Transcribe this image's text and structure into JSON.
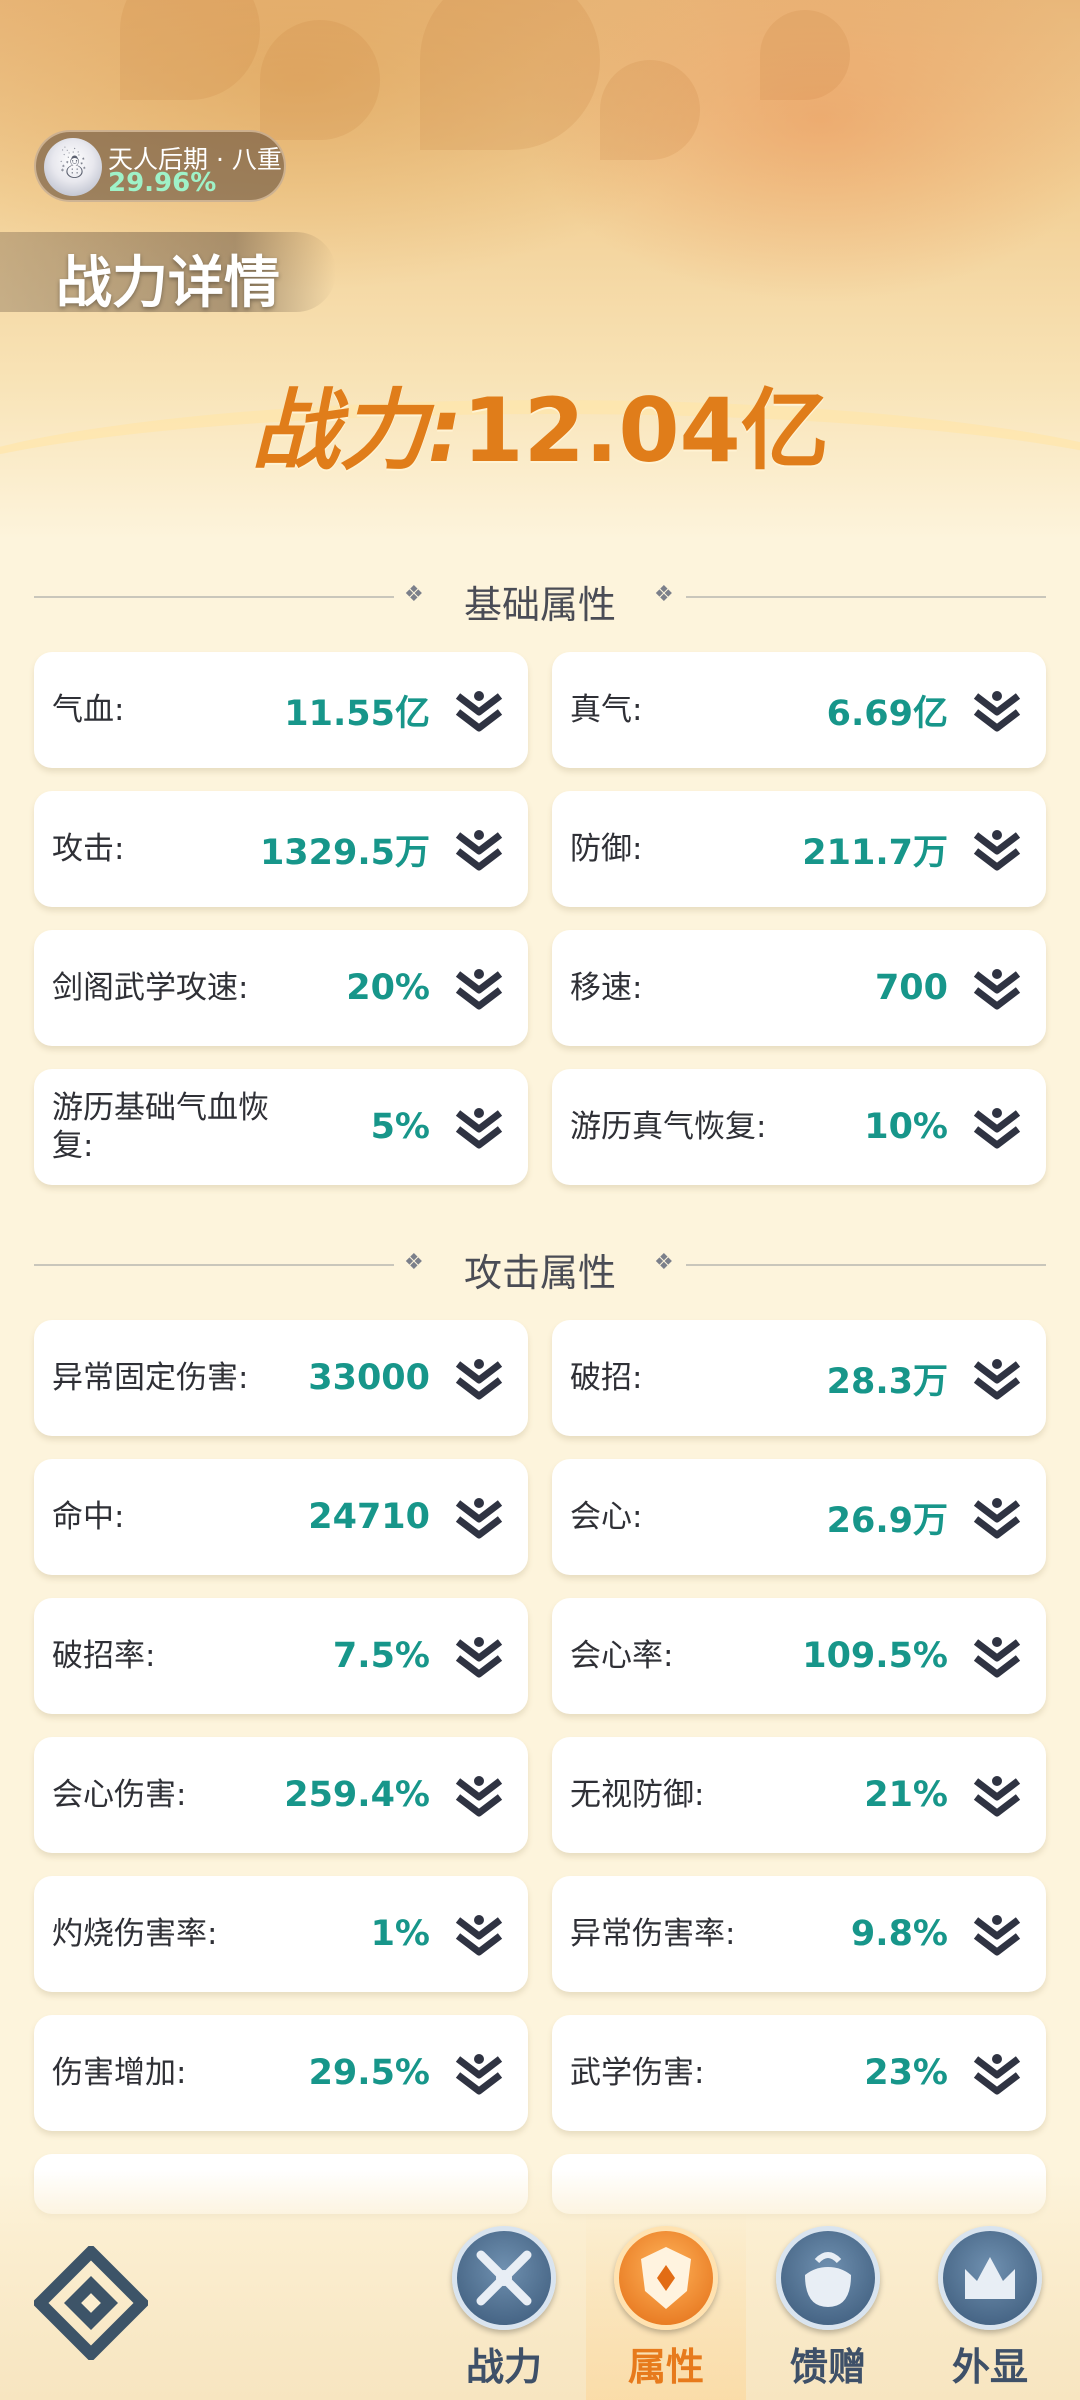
{
  "header": {
    "realm_title": "天人后期 · 八重",
    "realm_percent": "29.96%",
    "page_title": "战力详情",
    "power_label": "战力:",
    "power_value": "12.04亿"
  },
  "sections": [
    {
      "title": "基础属性",
      "stats": [
        {
          "label": "气血:",
          "value": "11.55亿"
        },
        {
          "label": "真气:",
          "value": "6.69亿"
        },
        {
          "label": "攻击:",
          "value": "1329.5万"
        },
        {
          "label": "防御:",
          "value": "211.7万"
        },
        {
          "label": "剑阁武学攻速:",
          "value": "20%"
        },
        {
          "label": "移速:",
          "value": "700"
        },
        {
          "label": "游历基础气血恢复:",
          "value": "5%"
        },
        {
          "label": "游历真气恢复:",
          "value": "10%"
        }
      ]
    },
    {
      "title": "攻击属性",
      "stats": [
        {
          "label": "异常固定伤害:",
          "value": "33000"
        },
        {
          "label": "破招:",
          "value": "28.3万"
        },
        {
          "label": "命中:",
          "value": "24710"
        },
        {
          "label": "会心:",
          "value": "26.9万"
        },
        {
          "label": "破招率:",
          "value": "7.5%"
        },
        {
          "label": "会心率:",
          "value": "109.5%"
        },
        {
          "label": "会心伤害:",
          "value": "259.4%"
        },
        {
          "label": "无视防御:",
          "value": "21%"
        },
        {
          "label": "灼烧伤害率:",
          "value": "1%"
        },
        {
          "label": "异常伤害率:",
          "value": "9.8%"
        },
        {
          "label": "伤害增加:",
          "value": "29.5%"
        },
        {
          "label": "武学伤害:",
          "value": "23%"
        }
      ]
    }
  ],
  "nav": {
    "items": [
      {
        "label": "战力",
        "icon": "swords-icon",
        "active": false
      },
      {
        "label": "属性",
        "icon": "shield-icon",
        "active": true
      },
      {
        "label": "馈赠",
        "icon": "gift-bag-icon",
        "active": false
      },
      {
        "label": "外显",
        "icon": "crown-icon",
        "active": false
      }
    ]
  },
  "colors": {
    "value_teal": "#17968a",
    "power_orange": "#e07d1a",
    "active_orange": "#e77a1c"
  }
}
